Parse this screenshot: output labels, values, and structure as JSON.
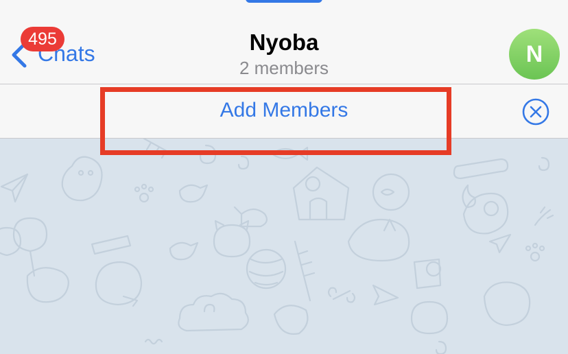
{
  "navbar": {
    "back_label": "Chats",
    "unread_badge": "495",
    "title": "Nyoba",
    "subtitle": "2 members",
    "avatar_initial": "N"
  },
  "action_bar": {
    "add_members_label": "Add Members"
  },
  "icons": {
    "back": "chevron-left-icon",
    "close": "close-circle-icon"
  },
  "colors": {
    "accent": "#3478e6",
    "badge": "#eb3b36",
    "avatar": "#7fcf62",
    "highlight": "#e63c26",
    "chat_background": "#d9e3ec"
  }
}
